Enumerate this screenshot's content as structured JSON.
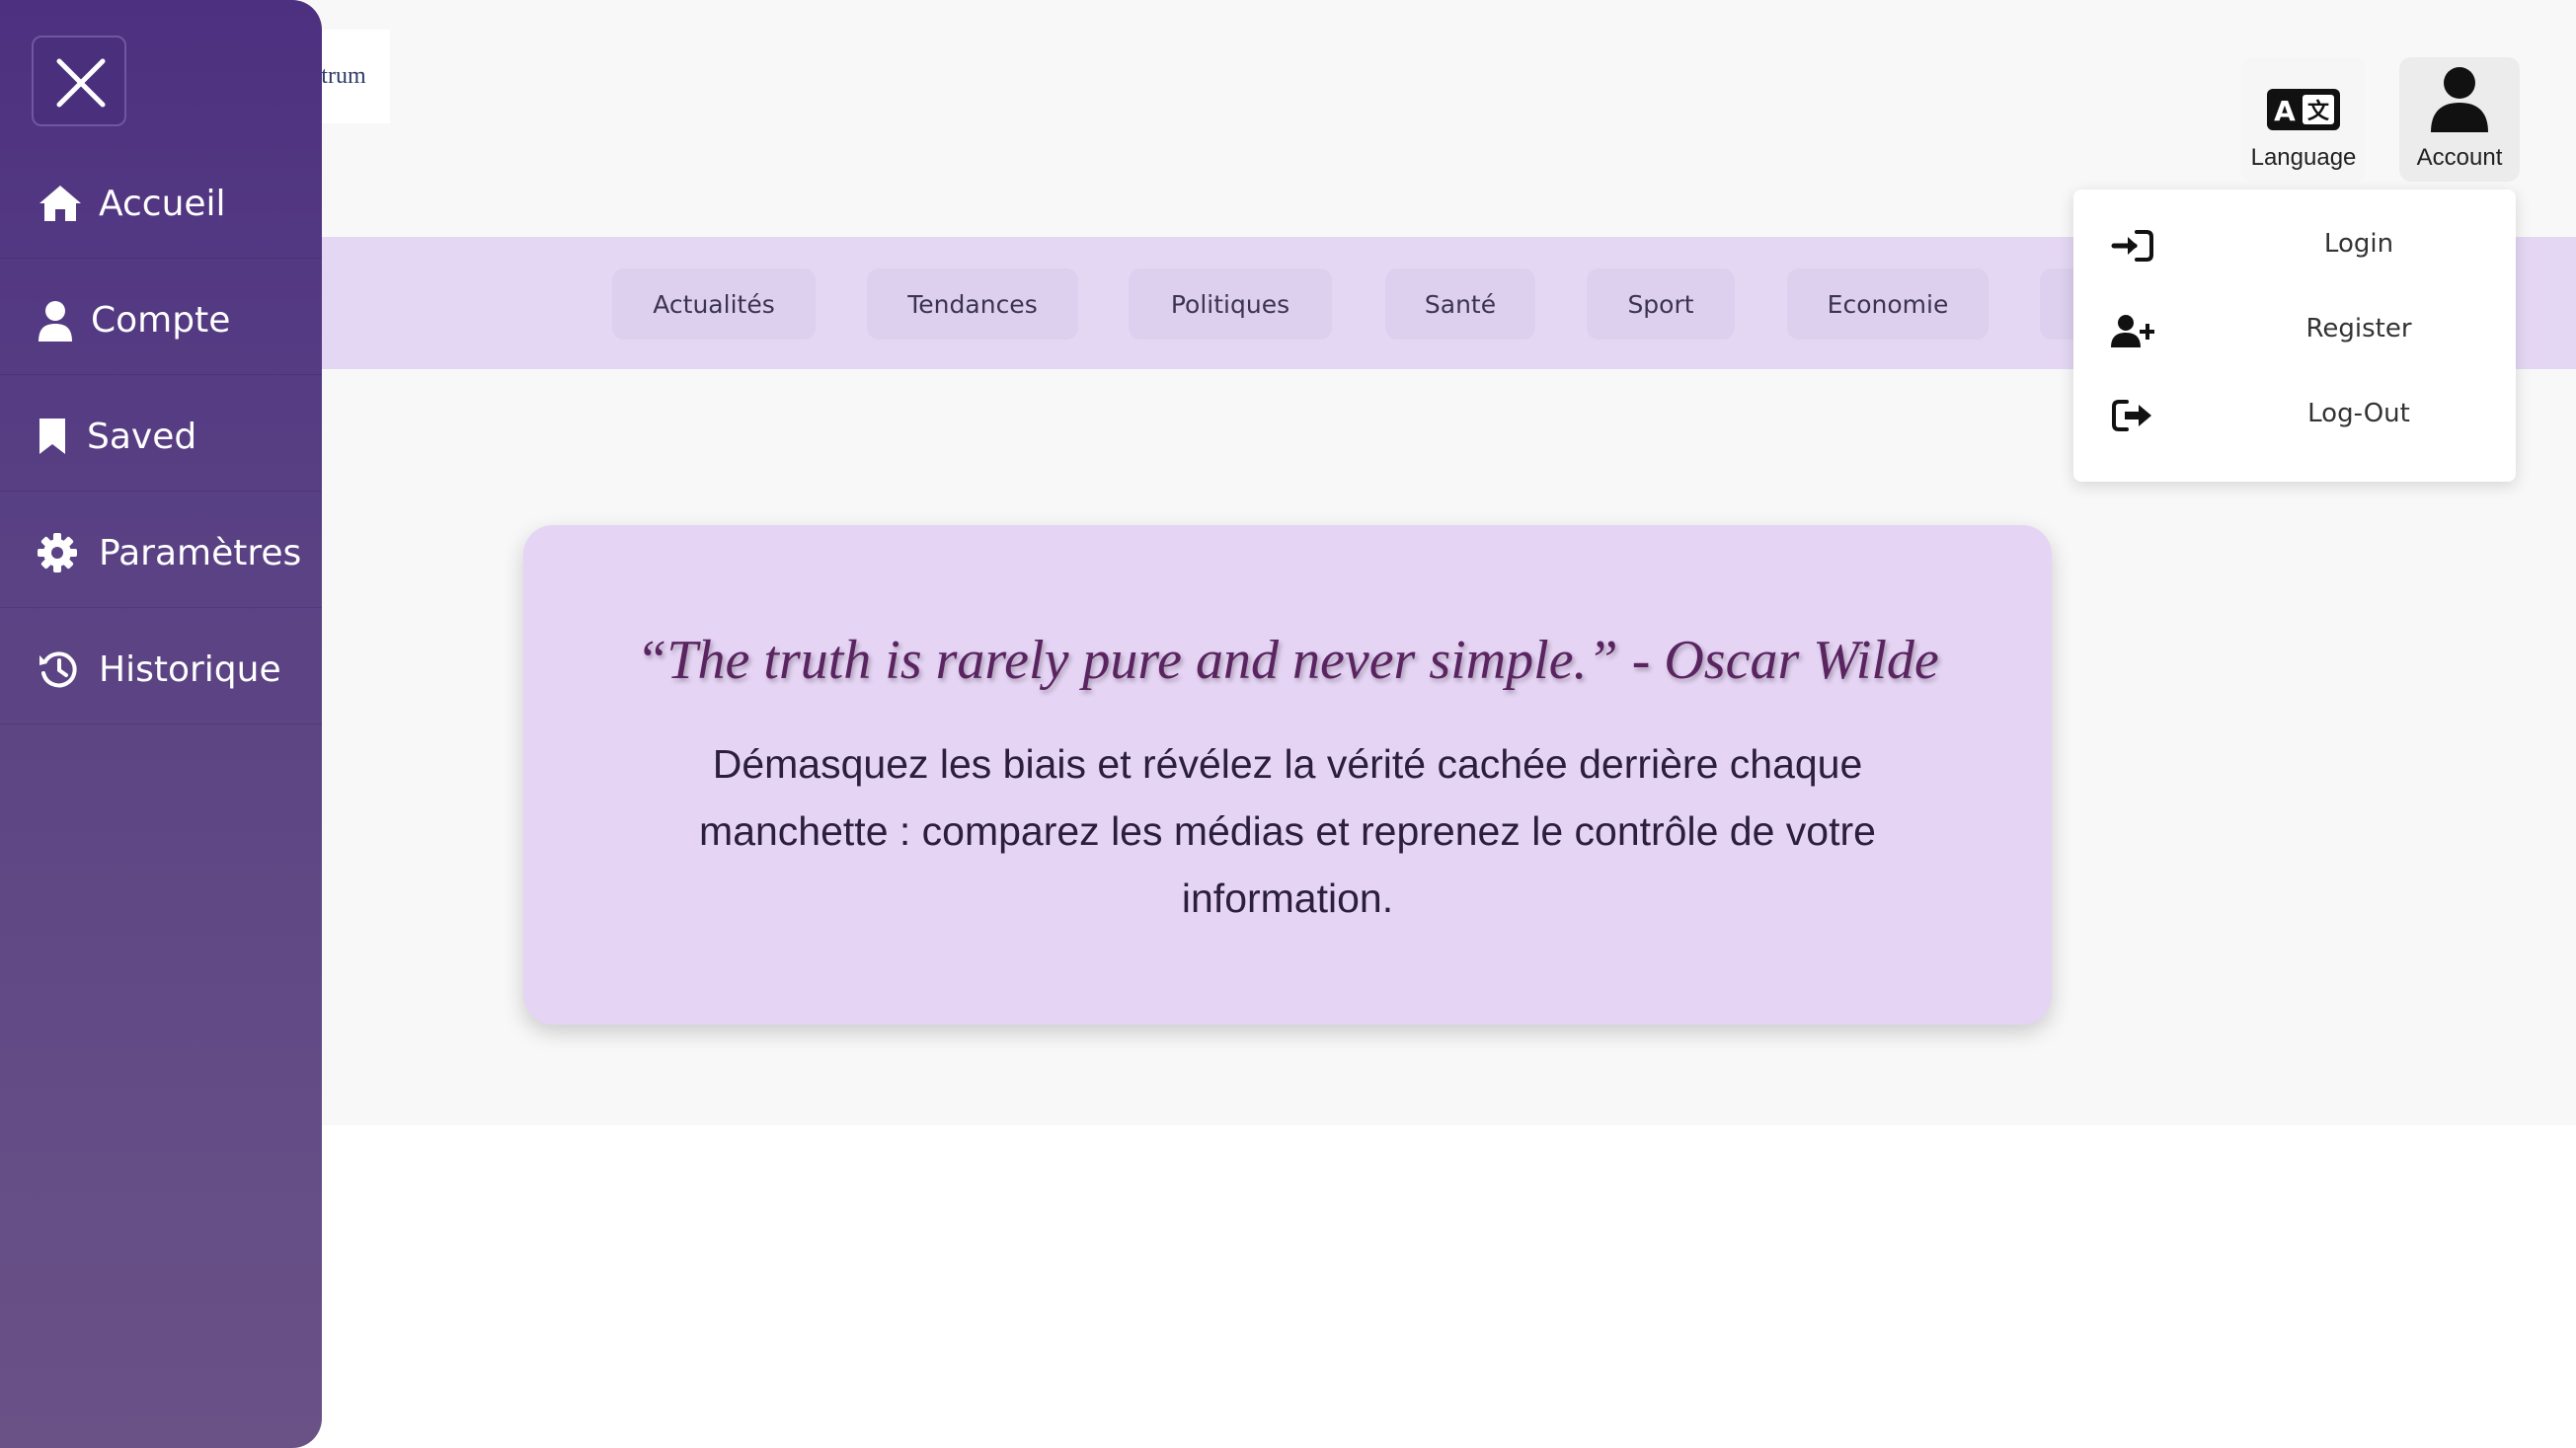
{
  "brand": {
    "logo_text": "News Spectrum"
  },
  "topbar": {
    "language_label": "Language",
    "account_label": "Account"
  },
  "nav": {
    "items": [
      "Actualités",
      "Tendances",
      "Politiques",
      "Santé",
      "Sport",
      "Economie"
    ]
  },
  "account_menu": {
    "items": [
      {
        "label": "Login",
        "icon": "login-icon"
      },
      {
        "label": "Register",
        "icon": "user-plus-icon"
      },
      {
        "label": "Log-Out",
        "icon": "logout-icon"
      }
    ]
  },
  "hero": {
    "quote": "“The truth is rarely pure and never simple.” - Oscar Wilde",
    "tagline": "Démasquez les biais et révélez la vérité cachée derrière chaque manchette : comparez les médias et reprenez le contrôle de votre information."
  },
  "sidebar": {
    "items": [
      {
        "label": "Accueil",
        "icon": "home-icon"
      },
      {
        "label": "Compte",
        "icon": "user-icon"
      },
      {
        "label": "Saved",
        "icon": "bookmark-icon"
      },
      {
        "label": "Paramètres",
        "icon": "gear-icon"
      },
      {
        "label": "Historique",
        "icon": "history-icon"
      }
    ]
  },
  "colors": {
    "sidebar": "#4d3080",
    "navbar": "#e4d7f4",
    "card": "#e5d4f4",
    "quote_text": "#5a2460"
  }
}
